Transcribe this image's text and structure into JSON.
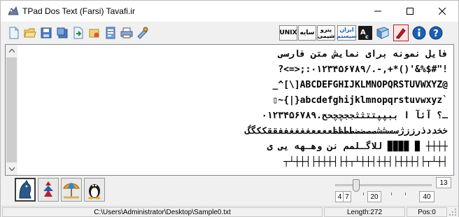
{
  "window": {
    "title": "TPad Dos Text (Farsi) Tavafi.ir"
  },
  "toolbar": {
    "icons": [
      "new-file-icon",
      "open-folder-icon",
      "save-icon",
      "save-as-icon",
      "export-icon",
      "insert-icon",
      "reverse-icon",
      "print-icon",
      "settings-icon"
    ],
    "unix_label": "UNIX",
    "saye_label": "سایه",
    "petro_label": "پترو شیمی",
    "iran_label": "ایران سیستم",
    "right_icons": [
      "font-toggle-icon",
      "book-icon",
      "edit-color-icon",
      "info-icon",
      "help-icon"
    ]
  },
  "editor": {
    "lines": [
      "فایل نمونه برای نمایش متن فارسی",
      "?<=>;:۰۱۲۳۴۵۶۷۸۹/.-,+*()'&%$#\"!",
      "_^[\\]ABCDEFGHIJKLMNOPQRSTUVWXYZ@",
      "▯~{|}abcdefghijklmnopqrstuvwxyz`",
      "۰۱۲۳۴۵۶۷۸۹.ـ؟ آئآ ا ببپپتتثثججچچحح",
      "خخددذرززژسسششصصضضططظظععععغغغغففققککگگ",
      "للاگـلمم نن وهـهه یی ی ▉▉▉▉ ▉ ┼┼┼┼",
      "┬┴┼┼┤├┼┼┼┤├┼┬┴┼┼┤┼┼┤├┼┼┼┤├┬┴┼┤"
    ]
  },
  "bottom": {
    "os_buttons": [
      "dos-cat-icon",
      "mac-apple-icon",
      "beach-umbrella-icon",
      "linux-penguin-icon"
    ],
    "slider_value": "13",
    "slider_fraction": 0.22,
    "val_a": "4",
    "val_b": "7",
    "val_c": "20",
    "val_d": "40"
  },
  "status": {
    "path": "C:\\Users\\Administrator\\Desktop\\Sample0.txt",
    "length": "Length:272",
    "pos": "Pos:0"
  },
  "colors": {
    "accent_blue": "#1a5fb4",
    "accent_red": "#c01c28",
    "window_bg": "#f0f0f0"
  }
}
